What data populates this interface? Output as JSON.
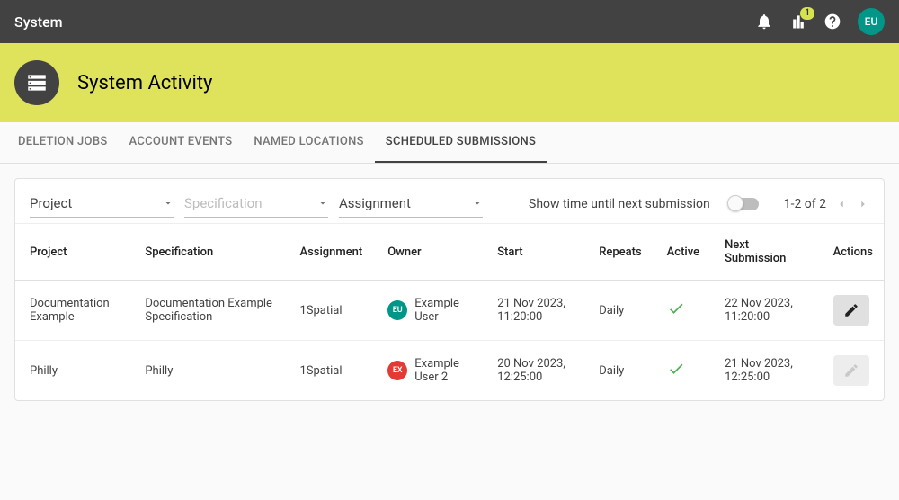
{
  "header": {
    "app_title": "System",
    "chart_badge": "1",
    "avatar_initials": "EU"
  },
  "page": {
    "title": "System Activity"
  },
  "tabs": {
    "deletion": "DELETION JOBS",
    "account": "ACCOUNT EVENTS",
    "named": "NAMED LOCATIONS",
    "scheduled": "SCHEDULED SUBMISSIONS"
  },
  "filters": {
    "project_label": "Project",
    "specification_placeholder": "Specification",
    "assignment_label": "Assignment",
    "toggle_label": "Show time until next submission",
    "pager_text": "1-2 of 2"
  },
  "table": {
    "headers": {
      "project": "Project",
      "specification": "Specification",
      "assignment": "Assignment",
      "owner": "Owner",
      "start": "Start",
      "repeats": "Repeats",
      "active": "Active",
      "next": "Next Submission",
      "actions": "Actions"
    },
    "rows": [
      {
        "project": "Documentation Example",
        "specification": "Documentation Example Specification",
        "assignment": "1Spatial",
        "owner_initials": "EU",
        "owner_name": "Example User",
        "owner_chip_color": "chip-green",
        "start": "21 Nov 2023, 11:20:00",
        "repeats": "Daily",
        "active": true,
        "next": "22 Nov 2023, 11:20:00",
        "edit_enabled": true
      },
      {
        "project": "Philly",
        "specification": "Philly",
        "assignment": "1Spatial",
        "owner_initials": "EX",
        "owner_name": "Example User 2",
        "owner_chip_color": "chip-red",
        "start": "20 Nov 2023, 12:25:00",
        "repeats": "Daily",
        "active": true,
        "next": "21 Nov 2023, 12:25:00",
        "edit_enabled": false
      }
    ]
  }
}
